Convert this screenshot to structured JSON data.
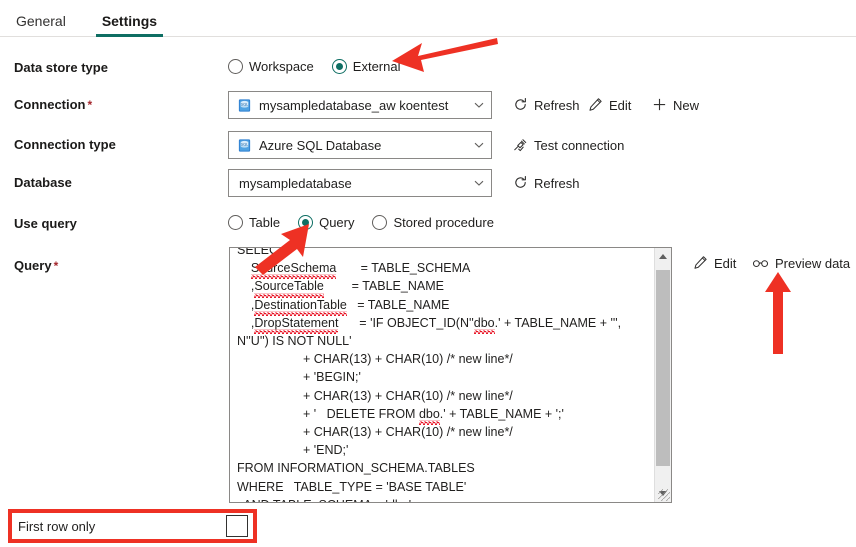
{
  "tabs": [
    {
      "label": "General",
      "active": false
    },
    {
      "label": "Settings",
      "active": true
    }
  ],
  "form": {
    "data_store_type": {
      "label": "Data store type",
      "options": [
        {
          "label": "Workspace",
          "selected": false
        },
        {
          "label": "External",
          "selected": true
        }
      ]
    },
    "connection": {
      "label": "Connection",
      "required": "*",
      "value": "mysampledatabase_aw koentest",
      "icon": "sql-database-icon",
      "commands": [
        {
          "label": "Refresh",
          "icon": "refresh-icon"
        },
        {
          "label": "Edit",
          "icon": "pencil-icon"
        },
        {
          "label": "New",
          "icon": "plus-icon"
        }
      ]
    },
    "connection_type": {
      "label": "Connection type",
      "value": "Azure SQL Database",
      "icon": "sql-database-icon",
      "commands": [
        {
          "label": "Test connection",
          "icon": "plug-check-icon"
        }
      ]
    },
    "database": {
      "label": "Database",
      "value": "mysampledatabase",
      "commands": [
        {
          "label": "Refresh",
          "icon": "refresh-icon"
        }
      ]
    },
    "use_query": {
      "label": "Use query",
      "options": [
        {
          "label": "Table",
          "selected": false
        },
        {
          "label": "Query",
          "selected": true
        },
        {
          "label": "Stored procedure",
          "selected": false
        }
      ]
    },
    "query": {
      "label": "Query",
      "required": "*",
      "lines": [
        {
          "text": "SELECT",
          "indent": 0
        },
        {
          "text": "    SourceSchema       = TABLE_SCHEMA",
          "indent": 0
        },
        {
          "text": "    ,SourceTable        = TABLE_NAME",
          "indent": 0
        },
        {
          "text": "    ,DestinationTable   = TABLE_NAME",
          "indent": 0
        },
        {
          "text": "    ,DropStatement      = 'IF OBJECT_ID(N''dbo.' + TABLE_NAME + ''',",
          "indent": 0
        },
        {
          "text": "N''U'') IS NOT NULL'",
          "indent": 0
        },
        {
          "text": "                   + CHAR(13) + CHAR(10) /* new line*/",
          "indent": 0
        },
        {
          "text": "                   + 'BEGIN;'",
          "indent": 0
        },
        {
          "text": "                   + CHAR(13) + CHAR(10) /* new line*/",
          "indent": 0
        },
        {
          "text": "                   + '   DELETE FROM dbo.' + TABLE_NAME + ';'",
          "indent": 0
        },
        {
          "text": "                   + CHAR(13) + CHAR(10) /* new line*/",
          "indent": 0
        },
        {
          "text": "                   + 'END;'",
          "indent": 0
        },
        {
          "text": "FROM INFORMATION_SCHEMA.TABLES",
          "indent": 0
        },
        {
          "text": "WHERE   TABLE_TYPE = 'BASE TABLE'",
          "indent": 0
        },
        {
          "text": "  AND TABLE_SCHEMA = 'dbo'",
          "indent": 0
        }
      ],
      "commands": [
        {
          "label": "Edit",
          "icon": "pencil-icon"
        },
        {
          "label": "Preview data",
          "icon": "glasses-icon"
        }
      ]
    },
    "first_row_only": {
      "label": "First row only",
      "checked": false
    }
  },
  "colors": {
    "accent_green": "#0e6e63",
    "annotation_red": "#ee3124",
    "required_red": "#a4262c",
    "icon_blue": "#2e7cd6",
    "border_gray": "#8a8886"
  }
}
